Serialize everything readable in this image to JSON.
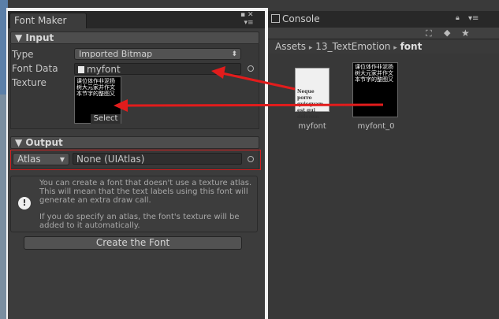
{
  "left_panel": {
    "tab_title": "Font Maker",
    "tab_controls": "▪ ✕\n▾≡",
    "input_section": {
      "header": "▼ Input",
      "type_label": "Type",
      "type_value": "Imported Bitmap",
      "font_data_label": "Font Data",
      "font_data_value": "myfont",
      "texture_label": "Texture",
      "texture_preview_text": "课位体作非泥扬树大元家并作文本节字的整图又",
      "select_label": "Select"
    },
    "output_section": {
      "header": "▼ Output",
      "atlas_label": "Atlas",
      "atlas_value": "None (UIAtlas)"
    },
    "help": {
      "icon_glyph": "!",
      "paragraph1": "You can create a font that doesn't use a texture atlas. This will mean that the text labels using this font will generate an extra draw call.",
      "paragraph2": "If you do specify an atlas, the font's texture will be added to it automatically."
    },
    "create_button": "Create the Font"
  },
  "right_panel": {
    "tab_title": "Console",
    "breadcrumb": {
      "part1": "Assets",
      "sep1": "▸",
      "part2": "13_TextEmotion",
      "sep2": "▸",
      "part3": "font"
    },
    "assets": [
      {
        "name": "myfont",
        "preview_text": "Neque porro quisquam est qui dolorem"
      },
      {
        "name": "myfont_0",
        "preview_text": "课位体作非泥扬树大元家并作文本节字的整图又"
      }
    ]
  },
  "colors": {
    "annotation_red": "#e21c1c"
  }
}
